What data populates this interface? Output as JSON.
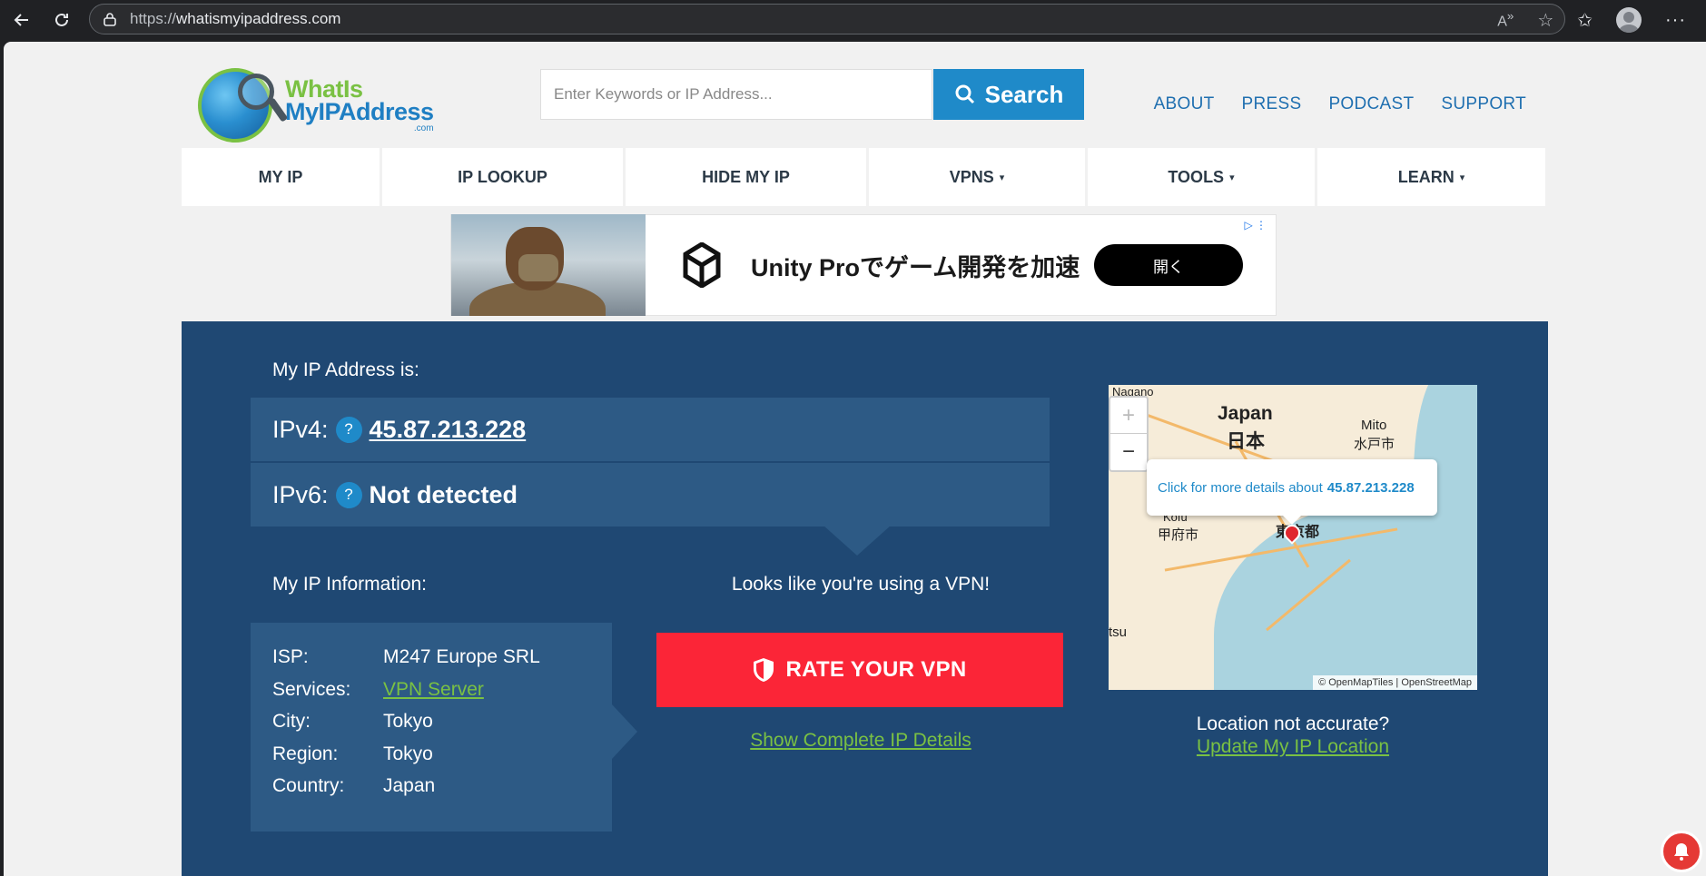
{
  "browser": {
    "url_proto": "https://",
    "url_host": "whatismyipaddress.com"
  },
  "logo": {
    "line1": "WhatIs",
    "line2": "MyIPAddress",
    "line3": ".com"
  },
  "search": {
    "placeholder": "Enter Keywords or IP Address...",
    "button": "Search"
  },
  "top_links": [
    "ABOUT",
    "PRESS",
    "PODCAST",
    "SUPPORT"
  ],
  "mainnav": [
    {
      "label": "MY IP",
      "caret": ""
    },
    {
      "label": "IP LOOKUP",
      "caret": ""
    },
    {
      "label": "HIDE MY IP",
      "caret": ""
    },
    {
      "label": "VPNS",
      "caret": "▾"
    },
    {
      "label": "TOOLS",
      "caret": "▾"
    },
    {
      "label": "LEARN",
      "caret": "▾"
    }
  ],
  "ad": {
    "text": "Unity Proでゲーム開発を加速",
    "button": "開く"
  },
  "ip": {
    "heading": "My IP Address is:",
    "ipv4_label": "IPv4:",
    "ipv4_value": "45.87.213.228",
    "ipv6_label": "IPv6:",
    "ipv6_value": "Not detected",
    "help": "?"
  },
  "info": {
    "heading": "My IP Information:",
    "rows": [
      {
        "k": "ISP:",
        "v": "M247 Europe SRL"
      },
      {
        "k": "Services:",
        "v": "VPN Server"
      },
      {
        "k": "City:",
        "v": "Tokyo"
      },
      {
        "k": "Region:",
        "v": "Tokyo"
      },
      {
        "k": "Country:",
        "v": "Japan"
      }
    ]
  },
  "vpn": {
    "message": "Looks like you're using a VPN!",
    "rate_button": "RATE YOUR VPN",
    "details_link": "Show Complete IP Details"
  },
  "map": {
    "labels": {
      "nagano": "Nagano",
      "japan": "Japan",
      "nihon": "日本",
      "mito": "Mito",
      "mito_jp": "水戸市",
      "kofu": "Kofu",
      "kofu_jp": "甲府市",
      "tokyo": "東京都",
      "tsu": "tsu"
    },
    "zoom_in": "+",
    "zoom_out": "−",
    "popup_text": "Click for more details about",
    "popup_ip": "45.87.213.228",
    "attribution": "© OpenMapTiles | OpenStreetMap"
  },
  "location": {
    "question": "Location not accurate?",
    "link": "Update My IP Location"
  }
}
